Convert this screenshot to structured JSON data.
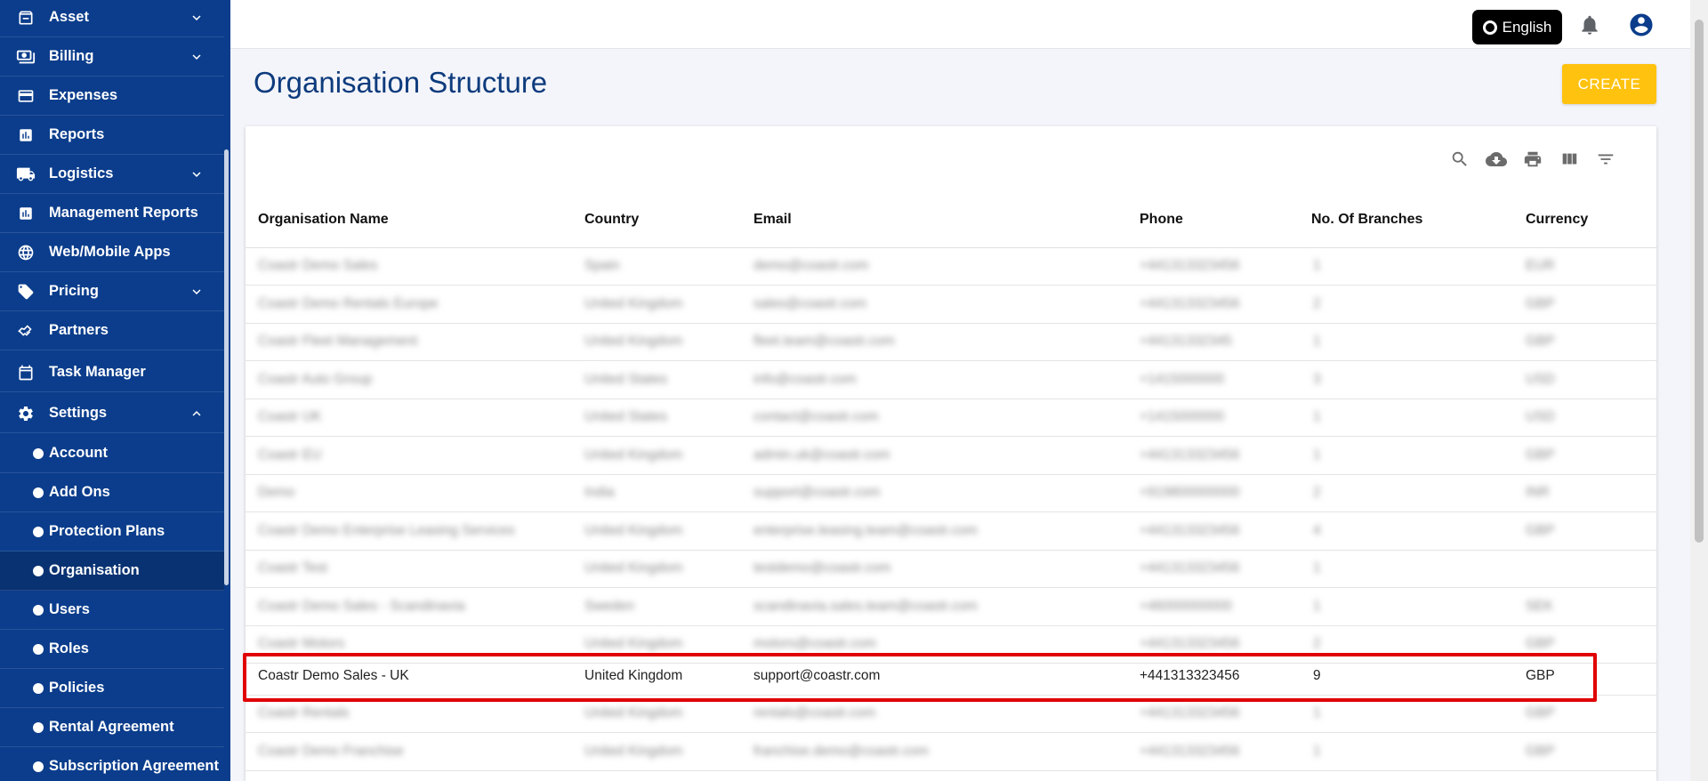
{
  "sidebar": {
    "items": [
      {
        "label": "Asset",
        "icon": "archive-icon",
        "chevron": "down"
      },
      {
        "label": "Billing",
        "icon": "cash-icon",
        "chevron": "down"
      },
      {
        "label": "Expenses",
        "icon": "credit-card-icon"
      },
      {
        "label": "Reports",
        "icon": "bar-chart-icon"
      },
      {
        "label": "Logistics",
        "icon": "truck-icon",
        "chevron": "down"
      },
      {
        "label": "Management Reports",
        "icon": "bar-chart-icon"
      },
      {
        "label": "Web/Mobile Apps",
        "icon": "globe-icon"
      },
      {
        "label": "Pricing",
        "icon": "tag-icon",
        "chevron": "down"
      },
      {
        "label": "Partners",
        "icon": "handshake-icon"
      },
      {
        "label": "Task Manager",
        "icon": "calendar-icon"
      },
      {
        "label": "Settings",
        "icon": "gear-icon",
        "chevron": "up"
      },
      {
        "label": "Account",
        "sub": true
      },
      {
        "label": "Add Ons",
        "sub": true
      },
      {
        "label": "Protection Plans",
        "sub": true
      },
      {
        "label": "Organisation",
        "sub": true,
        "active": true
      },
      {
        "label": "Users",
        "sub": true
      },
      {
        "label": "Roles",
        "sub": true
      },
      {
        "label": "Policies",
        "sub": true
      },
      {
        "label": "Rental Agreement",
        "sub": true
      },
      {
        "label": "Subscription Agreement",
        "sub": true
      }
    ]
  },
  "topbar": {
    "language": "English"
  },
  "page": {
    "title": "Organisation Structure",
    "create_label": "CREATE"
  },
  "table": {
    "columns": [
      "Organisation Name",
      "Country",
      "Email",
      "Phone",
      "No. Of Branches",
      "Currency"
    ],
    "blurred_rows": [
      [
        "Coastr Demo Sales",
        "Spain",
        "demo@coastr.com",
        "+441313323456",
        "1",
        "EUR"
      ],
      [
        "Coastr Demo Rentals Europe",
        "United Kingdom",
        "sales@coastr.com",
        "+441313323456",
        "2",
        "GBP"
      ],
      [
        "Coastr Fleet Management",
        "United Kingdom",
        "fleet.team@coastr.com",
        "+44131332345",
        "1",
        "GBP"
      ],
      [
        "Coastr Auto Group",
        "United States",
        "info@coastr.com",
        "+1415000000",
        "3",
        "USD"
      ],
      [
        "Coastr UK",
        "United States",
        "contact@coastr.com",
        "+1415000000",
        "1",
        "USD"
      ],
      [
        "Coastr EU",
        "United Kingdom",
        "admin.uk@coastr.com",
        "+441313323456",
        "1",
        "GBP"
      ],
      [
        "Demo",
        "India",
        "support@coastr.com",
        "+919800000000",
        "2",
        "INR"
      ],
      [
        "Coastr Demo Enterprise Leasing Services",
        "United Kingdom",
        "enterprise.leasing.team@coastr.com",
        "+441313323456",
        "4",
        "GBP"
      ],
      [
        "Coastr Test",
        "United Kingdom",
        "testdemo@coastr.com",
        "+441313323456",
        "1",
        ""
      ],
      [
        "Coastr Demo Sales - Scandinavia",
        "Sweden",
        "scandinavia.sales.team@coastr.com",
        "+46000000000",
        "1",
        "SEK"
      ],
      [
        "Coastr Motors",
        "United Kingdom",
        "motors@coastr.com",
        "+441313323456",
        "2",
        "GBP"
      ]
    ],
    "highlighted_row": [
      "Coastr Demo Sales - UK",
      "United Kingdom",
      "support@coastr.com",
      "+441313323456",
      "9",
      "GBP"
    ],
    "after_rows": [
      [
        "Coastr Rentals",
        "United Kingdom",
        "rentals@coastr.com",
        "+441313323456",
        "1",
        "GBP"
      ],
      [
        "Coastr Demo Franchise",
        "United Kingdom",
        "franchise.demo@coastr.com",
        "+441313323456",
        "1",
        "GBP"
      ]
    ]
  }
}
